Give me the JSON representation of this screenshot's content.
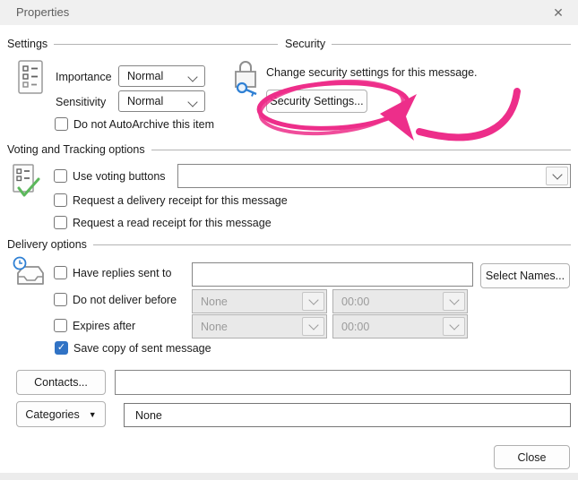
{
  "window": {
    "title": "Properties"
  },
  "icons": {
    "close": "✕",
    "check": "✓",
    "dropdown_triangle": "▼"
  },
  "settings": {
    "header": "Settings",
    "importance_label": "Importance",
    "importance_value": "Normal",
    "sensitivity_label": "Sensitivity",
    "sensitivity_value": "Normal",
    "autoarchive_label": "Do not AutoArchive this item"
  },
  "security": {
    "header": "Security",
    "description": "Change security settings for this message.",
    "button_label": "Security Settings..."
  },
  "voting": {
    "header": "Voting and Tracking options",
    "use_voting_label": "Use voting buttons",
    "voting_value": "",
    "delivery_receipt_label": "Request a delivery receipt for this message",
    "read_receipt_label": "Request a read receipt for this message"
  },
  "delivery": {
    "header": "Delivery options",
    "replies_label": "Have replies sent to",
    "replies_value": "",
    "select_names_label": "Select Names...",
    "deliver_before_label": "Do not deliver before",
    "deliver_before_date": "None",
    "deliver_before_time": "00:00",
    "expires_label": "Expires after",
    "expires_date": "None",
    "expires_time": "00:00",
    "save_copy_label": "Save copy of sent message"
  },
  "footer": {
    "contacts_label": "Contacts...",
    "contacts_value": "",
    "categories_label": "Categories",
    "categories_value": "None",
    "close_label": "Close"
  },
  "annotation": {
    "color": "#ed2e8a",
    "shape": "ellipse-around-security-settings-with-arrow"
  }
}
